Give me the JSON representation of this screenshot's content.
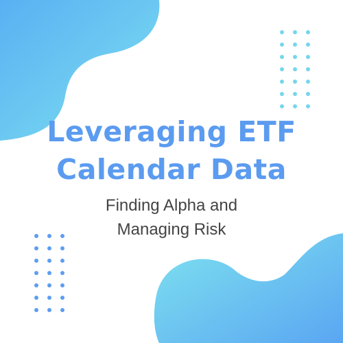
{
  "headline": {
    "line1": "Leveraging ETF",
    "line2": "Calendar Data"
  },
  "subheadline": {
    "line1": "Finding Alpha and",
    "line2": "Managing Risk"
  },
  "colors": {
    "title": "#5b9bf0",
    "subtitle": "#444444",
    "blob_gradient_start": "#7fe0f0",
    "blob_gradient_end": "#5aa8f2",
    "dots": "#6fd3ec",
    "dots_lower": "#5a9cf0"
  }
}
